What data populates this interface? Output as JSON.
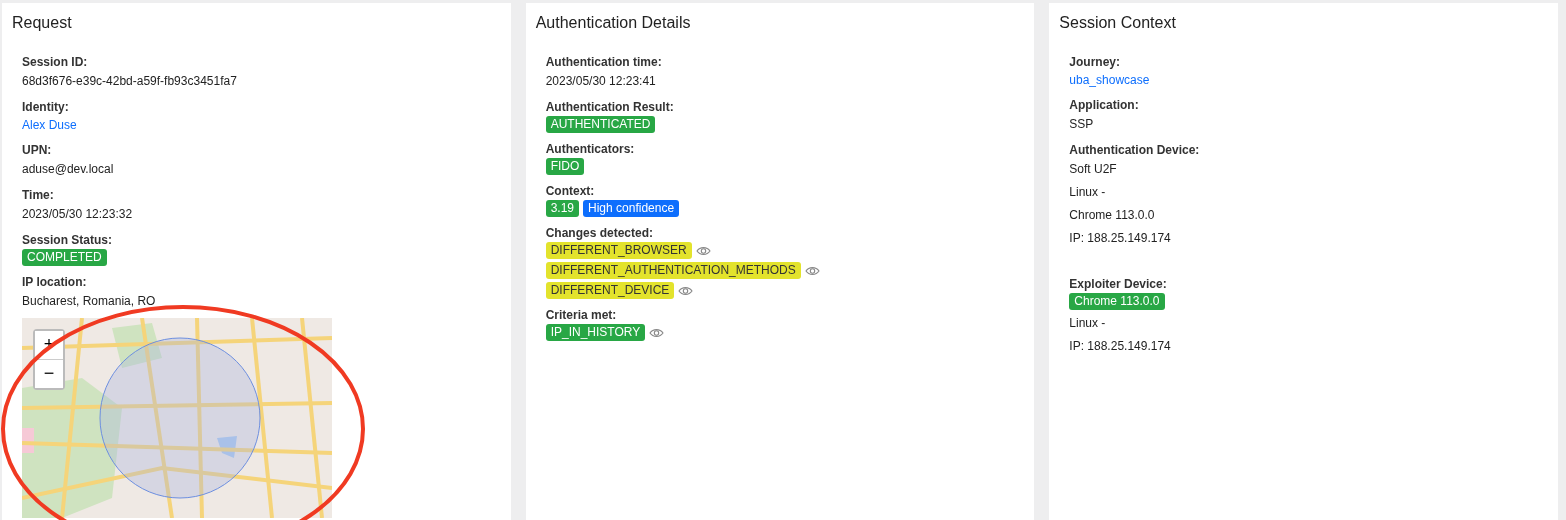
{
  "cards": [
    {
      "title": "Request",
      "fields": [
        {
          "label": "Session ID:",
          "values": [
            {
              "kind": "text",
              "text": "68d3f676-e39c-42bd-a59f-fb93c3451fa7"
            }
          ]
        },
        {
          "label": "Identity:",
          "values": [
            {
              "kind": "link",
              "text": "Alex Duse"
            }
          ]
        },
        {
          "label": "UPN:",
          "values": [
            {
              "kind": "text",
              "text": "aduse@dev.local"
            }
          ]
        },
        {
          "label": "Time:",
          "values": [
            {
              "kind": "text",
              "text": "2023/05/30 12:23:32"
            }
          ]
        },
        {
          "label": "Session Status:",
          "values": [
            {
              "kind": "badge",
              "text": "COMPLETED",
              "color": "#28a745",
              "details": false
            }
          ]
        },
        {
          "label": "IP location:",
          "values": [
            {
              "kind": "text",
              "text": "Bucharest, Romania, RO"
            }
          ]
        }
      ],
      "map": {
        "zoom_in": "+",
        "zoom_out": "−"
      }
    },
    {
      "title": "Authentication Details",
      "fields": [
        {
          "label": "Authentication time:",
          "values": [
            {
              "kind": "text",
              "text": "2023/05/30 12:23:41"
            }
          ]
        },
        {
          "label": "Authentication Result:",
          "values": [
            {
              "kind": "badge",
              "text": "AUTHENTICATED",
              "color": "#28a745",
              "details": false
            }
          ]
        },
        {
          "label": "Authenticators:",
          "values": [
            {
              "kind": "badge",
              "text": "FIDO",
              "color": "#28a745",
              "details": false
            }
          ]
        },
        {
          "label": "Context:",
          "inline": true,
          "values": [
            {
              "kind": "badge",
              "text": "3.19",
              "color": "#28a745",
              "details": false
            },
            {
              "kind": "badge",
              "text": "High confidence",
              "color": "#0d6efd",
              "details": false
            }
          ]
        },
        {
          "label": "Changes detected:",
          "values": [
            {
              "kind": "badge",
              "text": "DIFFERENT_BROWSER",
              "color": "#e3e32c",
              "details": true
            },
            {
              "kind": "badge",
              "text": "DIFFERENT_AUTHENTICATION_METHODS",
              "color": "#e3e32c",
              "details": true
            },
            {
              "kind": "badge",
              "text": "DIFFERENT_DEVICE",
              "color": "#e3e32c",
              "details": true
            }
          ]
        },
        {
          "label": "Criteria met:",
          "values": [
            {
              "kind": "badge",
              "text": "IP_IN_HISTORY",
              "color": "#28a745",
              "details": true
            }
          ]
        }
      ]
    },
    {
      "title": "Session Context",
      "fields": [
        {
          "label": "Journey:",
          "values": [
            {
              "kind": "link",
              "text": "uba_showcase"
            }
          ]
        },
        {
          "label": "Application:",
          "values": [
            {
              "kind": "text",
              "text": "SSP"
            }
          ]
        },
        {
          "label": "Authentication Device:",
          "values": [
            {
              "kind": "text",
              "text": "Soft U2F"
            },
            {
              "kind": "text",
              "text": "Linux -"
            },
            {
              "kind": "text",
              "text": "Chrome 113.0.0"
            },
            {
              "kind": "text",
              "text": "IP: 188.25.149.174"
            }
          ]
        },
        {
          "label": "Exploiter Device:",
          "separated": true,
          "values": [
            {
              "kind": "badge",
              "text": "Chrome 113.0.0",
              "color": "#28a745",
              "details": false
            },
            {
              "kind": "text",
              "text": "Linux -"
            },
            {
              "kind": "text",
              "text": "IP: 188.25.149.174"
            }
          ]
        }
      ]
    }
  ]
}
